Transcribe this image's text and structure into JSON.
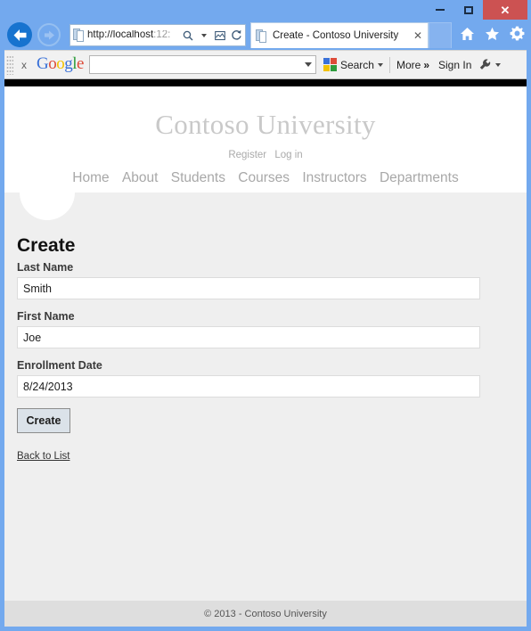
{
  "window": {
    "buttons": {
      "minimize": "minimize",
      "maximize": "maximize",
      "close": "✕"
    }
  },
  "browser": {
    "back_label": "←",
    "forward_label": "→",
    "address": {
      "scheme_host": "http://localhost",
      "port_visible": ":12:",
      "full_visible": "http://localhost:12:",
      "search_icon": "⚲",
      "compat_icon": "☒",
      "refresh_icon": "↻"
    },
    "tab": {
      "title": "Create - Contoso University",
      "close": "✕"
    },
    "chrome_icons": {
      "home": "⌂",
      "favorites": "★",
      "settings": "⚙"
    }
  },
  "google_toolbar": {
    "close": "x",
    "logo": {
      "g1": "G",
      "o1": "o",
      "o2": "o",
      "g2": "g",
      "l": "l",
      "e": "e"
    },
    "search_value": "",
    "search_button": "Search",
    "more_label": "More",
    "more_chevron": "»",
    "sign_in": "Sign In",
    "wrench_icon": "🔧"
  },
  "site": {
    "brand": "Contoso University",
    "auth_links": [
      {
        "label": "Register"
      },
      {
        "label": "Log in"
      }
    ],
    "nav": [
      {
        "label": "Home"
      },
      {
        "label": "About"
      },
      {
        "label": "Students"
      },
      {
        "label": "Courses"
      },
      {
        "label": "Instructors"
      },
      {
        "label": "Departments"
      }
    ],
    "footer": "© 2013 - Contoso University"
  },
  "form": {
    "title": "Create",
    "fields": [
      {
        "label": "Last Name",
        "value": "Smith"
      },
      {
        "label": "First Name",
        "value": "Joe"
      },
      {
        "label": "Enrollment Date",
        "value": "8/24/2013"
      }
    ],
    "submit_label": "Create",
    "back_link": "Back to List"
  },
  "colors": {
    "chrome_blue": "#73a9ee",
    "close_red": "#cc5252",
    "content_gray": "#efefef",
    "footer_gray": "#dedede",
    "brand_gray": "#c9c9c9",
    "nav_gray": "#a8a8a8",
    "button_face": "#dbe2e9"
  }
}
